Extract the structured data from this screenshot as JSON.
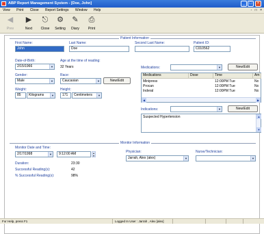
{
  "window": {
    "title": "ABP Report Management System - [Doe, John]",
    "buttons": {
      "minimize": "_",
      "maximize": "□",
      "close": "×"
    },
    "mdi": {
      "minimize": "-",
      "restore": "□",
      "close": "×"
    }
  },
  "menu": [
    "View",
    "Print",
    "Close",
    "Report Settings",
    "Window",
    "Help"
  ],
  "toolbar": [
    {
      "label": "Prev",
      "icon": "arrow-left-icon",
      "glyph": "◀",
      "enabled": false
    },
    {
      "label": "Next",
      "icon": "arrow-right-icon",
      "glyph": "▶",
      "enabled": true
    },
    {
      "label": "Close",
      "icon": "close-door-icon",
      "glyph": "⎋",
      "enabled": true
    },
    {
      "label": "Setting",
      "icon": "gear-icon",
      "glyph": "⚙",
      "enabled": true
    },
    {
      "label": "Diary",
      "icon": "diary-icon",
      "glyph": "✎",
      "enabled": true
    },
    {
      "label": "Print",
      "icon": "printer-icon",
      "glyph": "⎙",
      "enabled": true
    }
  ],
  "patient": {
    "section_title": "Patient Information",
    "first_name_label": "First Name:",
    "first_name": "John",
    "last_name_label": "Last Name:",
    "last_name": "Doe",
    "second_last_name_label": "Second Last Name:",
    "second_last_name": "",
    "patient_id_label": "Patient ID:",
    "patient_id": "C010562",
    "dob_label": "Date-of-Birth:",
    "dob": "2/15/1966",
    "age_label": "Age at the time of reading:",
    "age": "32 Years",
    "gender_label": "Gender:",
    "gender": "Male",
    "race_label": "Race:",
    "race": "Caucasian",
    "race_new_edit": "New/Edit",
    "weight_label": "Weight:",
    "weight": "85",
    "weight_unit": "Kilograms",
    "height_label": "Height:",
    "height": "171",
    "height_unit": "Centimeters"
  },
  "medications": {
    "label": "Medications:",
    "combo_value": "",
    "new_edit": "New/Edit",
    "columns": [
      "Medications",
      "Dose",
      "Time",
      "Am"
    ],
    "rows": [
      {
        "name": "Minipress",
        "dose": "",
        "time": "12:00PM Tue",
        "am": "No"
      },
      {
        "name": "Procan",
        "dose": "",
        "time": "12:00PM Tue",
        "am": "No"
      },
      {
        "name": "Inderal",
        "dose": "",
        "time": "12:00PM Tue",
        "am": "No"
      }
    ]
  },
  "indications": {
    "label": "Indications:",
    "combo_value": "",
    "new_edit": "New/Edit",
    "text": "Suspected Hypertension"
  },
  "monitor": {
    "section_title": "Monitor Information",
    "start_label": "Monitor Date and Time:",
    "date": "2/17/1998",
    "time": "9:12:00 AM",
    "duration_label": "Duration:",
    "duration": "23:30",
    "successful_label": "Successful Reading(s):",
    "successful": "42",
    "pct_label": "% Successful Reading(s):",
    "pct": "98%",
    "physician_label": "Physician:",
    "physician": "Jarrah, Alex (alex)",
    "nurse_label": "Nurse/Technician:",
    "nurse": ""
  },
  "status": {
    "help": "For Help, press F1",
    "user": "Logged In User : Jarrah , Alex [alex]"
  }
}
